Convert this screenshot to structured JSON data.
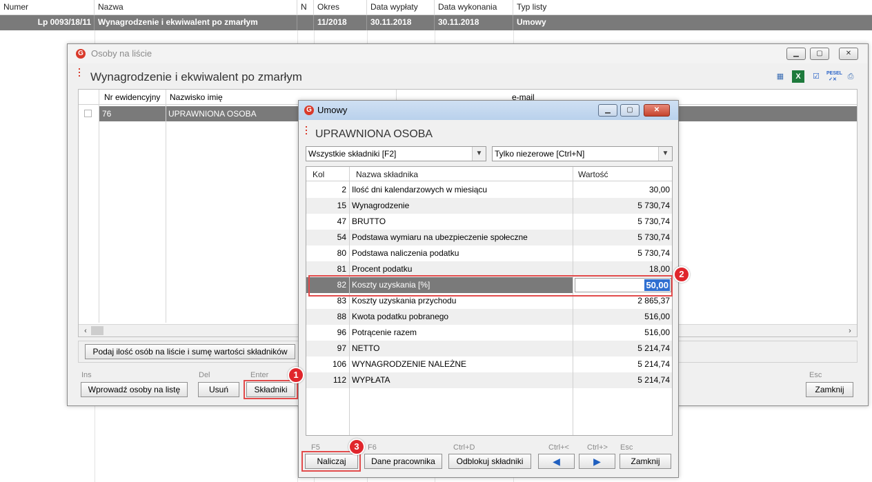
{
  "background_list": {
    "columns": [
      "Numer",
      "Nazwa",
      "N",
      "Okres",
      "Data wypłaty",
      "Data wykonania",
      "Typ listy"
    ],
    "row": {
      "numer": "Lp 0093/18/11",
      "nazwa": "Wynagrodzenie i ekwiwalent po zmarłym",
      "n": "",
      "okres": "11/2018",
      "data_wyplaty": "30.11.2018",
      "data_wykonania": "30.11.2018",
      "typ_listy": "Umowy"
    }
  },
  "window_osoby": {
    "title": "Osoby na liście",
    "heading": "Wynagrodzenie i ekwiwalent po zmarłym",
    "toolbar_icons": [
      "table-icon",
      "excel-icon",
      "checkbox-icon",
      "pesel-icon",
      "print-icon"
    ],
    "pesel_label": "PESEL",
    "grid": {
      "columns": [
        "Nr ewidencyjny",
        "Nazwisko imię",
        "e-mail"
      ],
      "rows": [
        {
          "nr": "76",
          "nazwisko": "UPRAWNIONA OSOBA"
        }
      ]
    },
    "summary_button": "Podaj ilość osób na liście i sumę wartości składników",
    "buttons": {
      "wprowadz": {
        "hint": "Ins",
        "label": "Wprowadź osoby na listę"
      },
      "usun": {
        "hint": "Del",
        "label": "Usuń"
      },
      "skladniki": {
        "hint": "Enter",
        "label": "Składniki"
      },
      "zamknij": {
        "hint": "Esc",
        "label": "Zamknij"
      }
    }
  },
  "window_umowy": {
    "title": "Umowy",
    "heading": "UPRAWNIONA OSOBA",
    "filter1": "Wszystkie składniki [F2]",
    "filter2": "Tylko niezerowe [Ctrl+N]",
    "grid": {
      "columns": [
        "Kol",
        "Nazwa składnika",
        "Wartość"
      ],
      "rows": [
        {
          "kol": "2",
          "nazwa": "Ilość dni kalendarzowych w miesiącu",
          "wartosc": "30,00"
        },
        {
          "kol": "15",
          "nazwa": "Wynagrodzenie",
          "wartosc": "5 730,74"
        },
        {
          "kol": "47",
          "nazwa": "BRUTTO",
          "wartosc": "5 730,74"
        },
        {
          "kol": "54",
          "nazwa": "Podstawa wymiaru na ubezpieczenie społeczne",
          "wartosc": "5 730,74"
        },
        {
          "kol": "80",
          "nazwa": "Podstawa naliczenia podatku",
          "wartosc": "5 730,74"
        },
        {
          "kol": "81",
          "nazwa": "Procent podatku",
          "wartosc": "18,00"
        },
        {
          "kol": "82",
          "nazwa": "Koszty uzyskania [%]",
          "wartosc": "50,00"
        },
        {
          "kol": "83",
          "nazwa": "Koszty uzyskania przychodu",
          "wartosc": "2 865,37"
        },
        {
          "kol": "88",
          "nazwa": "Kwota podatku pobranego",
          "wartosc": "516,00"
        },
        {
          "kol": "96",
          "nazwa": "Potrącenie razem",
          "wartosc": "516,00"
        },
        {
          "kol": "97",
          "nazwa": "NETTO",
          "wartosc": "5 214,74"
        },
        {
          "kol": "106",
          "nazwa": "WYNAGRODZENIE NALEŻNE",
          "wartosc": "5 214,74"
        },
        {
          "kol": "112",
          "nazwa": "WYPŁATA",
          "wartosc": "5 214,74"
        }
      ]
    },
    "buttons": {
      "naliczaj": {
        "hint": "F5",
        "label": "Naliczaj"
      },
      "dane": {
        "hint": "F6",
        "label": "Dane pracownika"
      },
      "odblokuj": {
        "hint": "Ctrl+D",
        "label": "Odblokuj składniki"
      },
      "prev": {
        "hint": "Ctrl+<"
      },
      "next": {
        "hint": "Ctrl+>"
      },
      "zamknij": {
        "hint": "Esc",
        "label": "Zamknij"
      }
    }
  },
  "badges": [
    "1",
    "2",
    "3"
  ],
  "colors": {
    "selection": "#7a7a7a",
    "accent_red": "#e0262c",
    "edit_highlight": "#2f6fd1"
  }
}
